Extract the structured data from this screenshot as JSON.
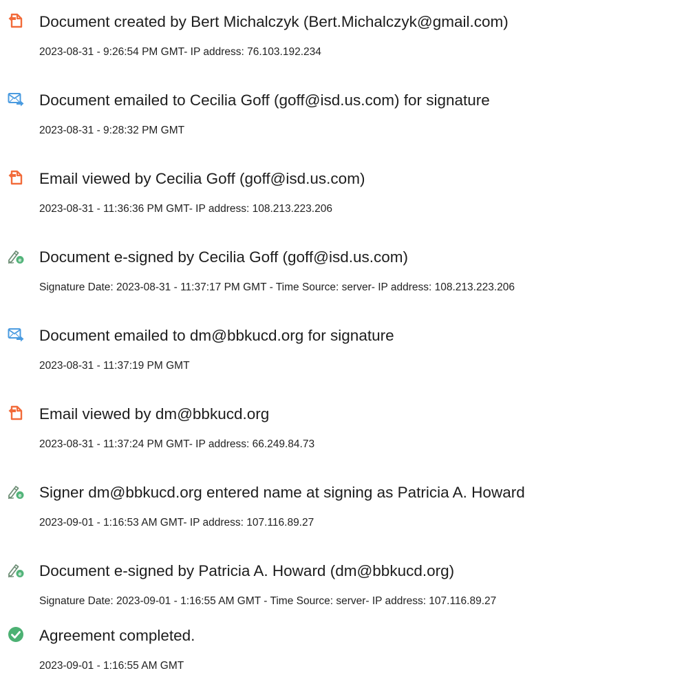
{
  "icons": {
    "document-created-icon": {
      "color": "#f26b3a"
    },
    "document-emailed-icon": {
      "color": "#4a9be0"
    },
    "email-viewed-icon": {
      "color": "#f26b3a"
    },
    "e-signed-icon": {
      "color": "#53b47a"
    },
    "agreement-completed-icon": {
      "color": "#4cb173"
    }
  },
  "events": [
    {
      "icon": "document-created-icon",
      "title": "Document created by Bert Michalczyk (Bert.Michalczyk@gmail.com)",
      "detail": "2023-08-31 - 9:26:54 PM GMT- IP address: 76.103.192.234"
    },
    {
      "icon": "document-emailed-icon",
      "title": "Document emailed to Cecilia Goff (goff@isd.us.com) for signature",
      "detail": "2023-08-31 - 9:28:32 PM GMT"
    },
    {
      "icon": "email-viewed-icon",
      "title": "Email viewed by Cecilia Goff (goff@isd.us.com)",
      "detail": "2023-08-31 - 11:36:36 PM GMT- IP address: 108.213.223.206"
    },
    {
      "icon": "e-signed-icon",
      "title": "Document e-signed by Cecilia Goff (goff@isd.us.com)",
      "detail": "Signature Date: 2023-08-31 - 11:37:17 PM GMT - Time Source: server- IP address: 108.213.223.206"
    },
    {
      "icon": "document-emailed-icon",
      "title": "Document emailed to dm@bbkucd.org for signature",
      "detail": "2023-08-31 - 11:37:19 PM GMT"
    },
    {
      "icon": "email-viewed-icon",
      "title": "Email viewed by dm@bbkucd.org",
      "detail": "2023-08-31 - 11:37:24 PM GMT- IP address: 66.249.84.73"
    },
    {
      "icon": "e-signed-icon",
      "title": "Signer dm@bbkucd.org entered name at signing as Patricia A. Howard",
      "detail": "2023-09-01 - 1:16:53 AM GMT- IP address: 107.116.89.27"
    },
    {
      "icon": "e-signed-icon",
      "title": "Document e-signed by Patricia A. Howard (dm@bbkucd.org)",
      "detail": "Signature Date: 2023-09-01 - 1:16:55 AM GMT - Time Source: server- IP address: 107.116.89.27"
    },
    {
      "icon": "agreement-completed-icon",
      "title": "Agreement completed.",
      "detail": "2023-09-01 - 1:16:55 AM GMT"
    }
  ]
}
